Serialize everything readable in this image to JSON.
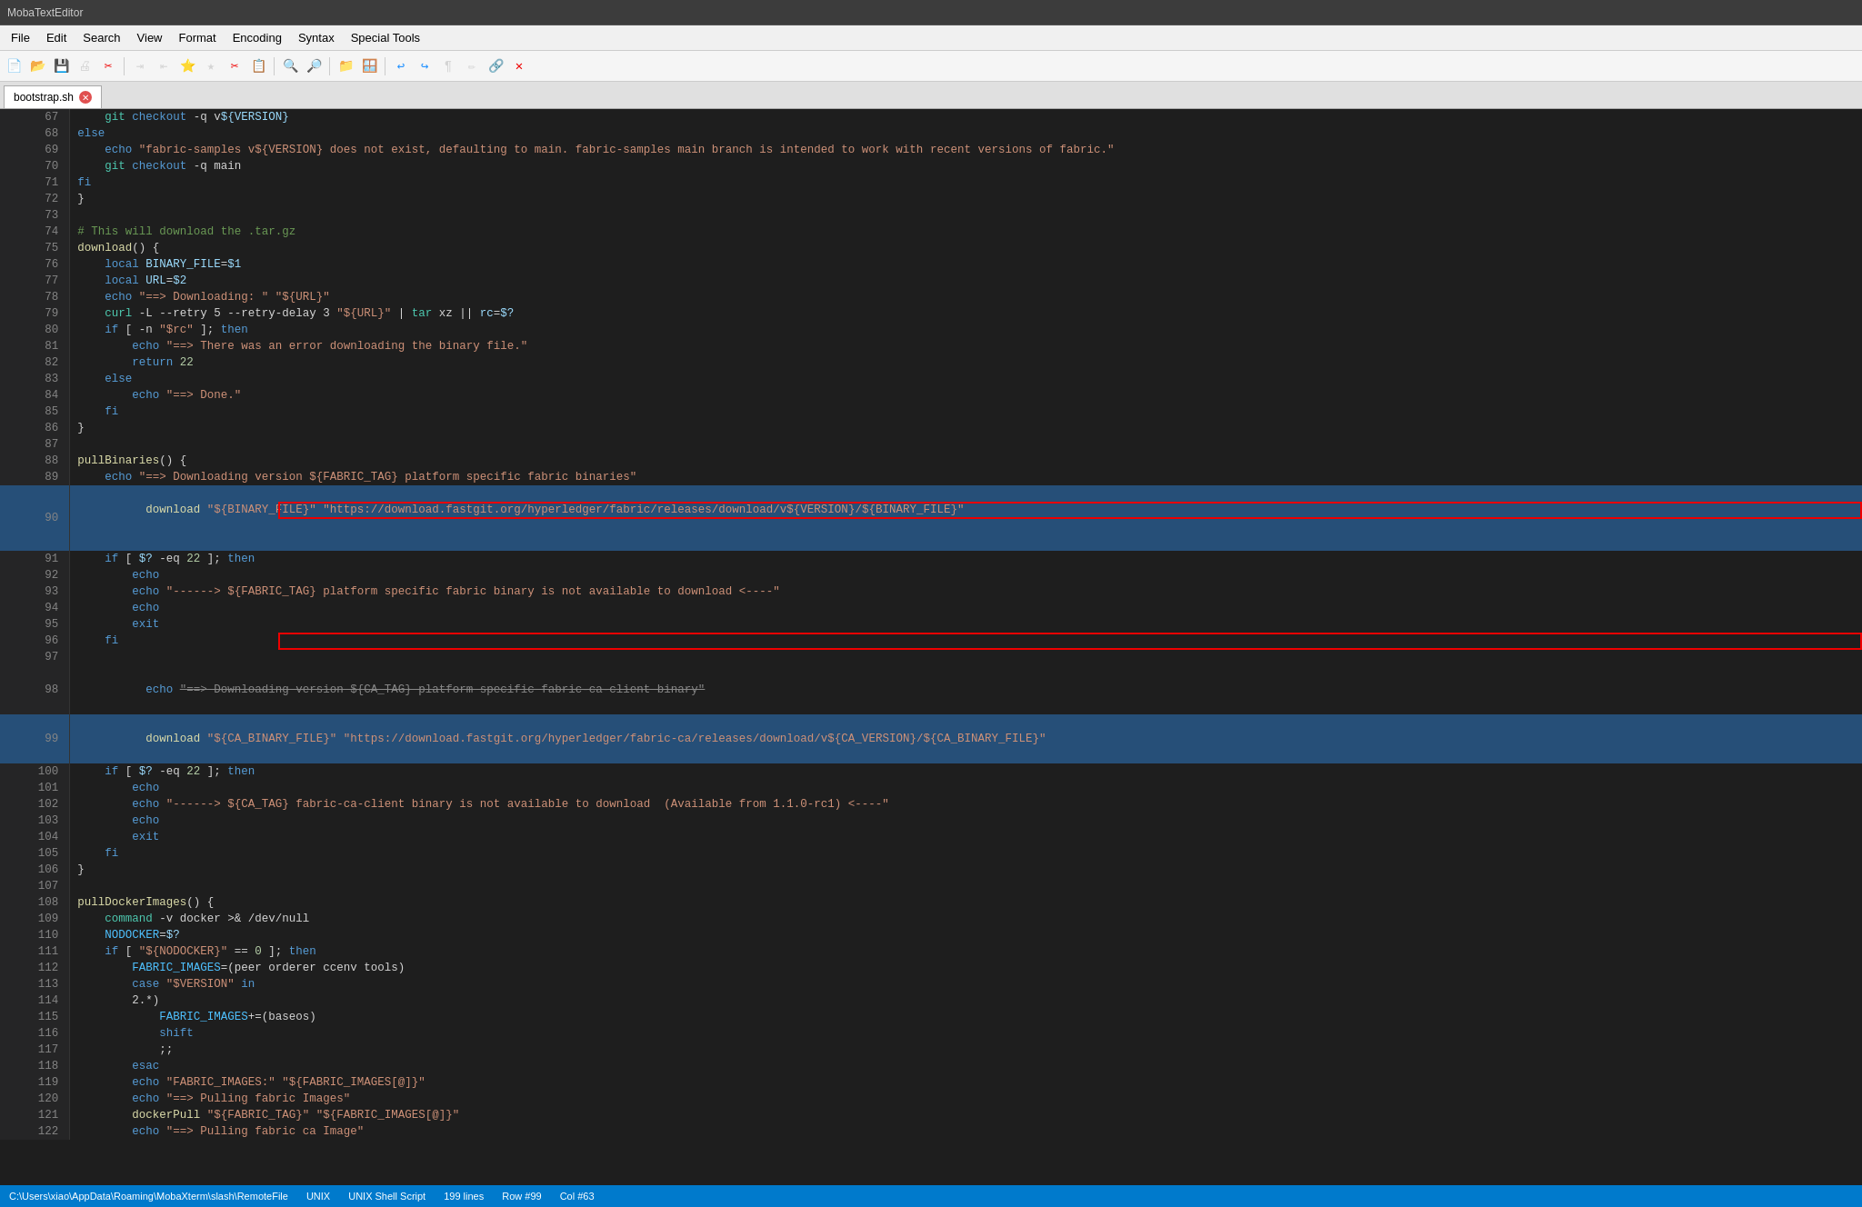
{
  "app": {
    "title": "MobaTextEditor"
  },
  "menubar": {
    "items": [
      "File",
      "Edit",
      "Search",
      "View",
      "Format",
      "Encoding",
      "Syntax",
      "Special Tools"
    ]
  },
  "tabs": [
    {
      "label": "bootstrap.sh",
      "active": true
    }
  ],
  "statusbar": {
    "path": "C:\\Users\\xiao\\AppData\\Roaming\\MobaXterm\\slash\\RemoteFile",
    "encoding": "UNIX",
    "type": "UNIX Shell Script",
    "lines": "199 lines",
    "row": "Row #99",
    "col": "Col #63"
  },
  "lines": [
    {
      "num": 67,
      "content": "    git checkout -q v${VERSION}"
    },
    {
      "num": 68,
      "content": "else"
    },
    {
      "num": 69,
      "content": "    echo \"fabric-samples v${VERSION} does not exist, defaulting to main. fabric-samples main branch is intended to work with recent versions of fabric.\""
    },
    {
      "num": 70,
      "content": "    git checkout -q main"
    },
    {
      "num": 71,
      "content": "fi"
    },
    {
      "num": 72,
      "content": "}"
    },
    {
      "num": 73,
      "content": ""
    },
    {
      "num": 74,
      "content": "# This will download the .tar.gz"
    },
    {
      "num": 75,
      "content": "download() {"
    },
    {
      "num": 76,
      "content": "    local BINARY_FILE=$1"
    },
    {
      "num": 77,
      "content": "    local URL=$2"
    },
    {
      "num": 78,
      "content": "    echo \"==> Downloading: \" \"${URL}\""
    },
    {
      "num": 79,
      "content": "    curl -L --retry 5 --retry-delay 3 \"${URL}\" | tar xz || rc=$?"
    },
    {
      "num": 80,
      "content": "    if [ -n \"$rc\" ]; then"
    },
    {
      "num": 81,
      "content": "        echo \"==> There was an error downloading the binary file.\""
    },
    {
      "num": 82,
      "content": "        return 22"
    },
    {
      "num": 83,
      "content": "    else"
    },
    {
      "num": 84,
      "content": "        echo \"==> Done.\""
    },
    {
      "num": 85,
      "content": "    fi"
    },
    {
      "num": 86,
      "content": "}"
    },
    {
      "num": 87,
      "content": ""
    },
    {
      "num": 88,
      "content": "pullBinaries() {"
    },
    {
      "num": 89,
      "content": "    echo \"==> Downloading version ${FABRIC_TAG} platform specific fabric binaries\""
    },
    {
      "num": 90,
      "content": "    download \"${BINARY_FILE}\" \"https://download.fastgit.org/hyperledger/fabric/releases/download/v${VERSION}/${BINARY_FILE}\"",
      "highlight": true
    },
    {
      "num": 91,
      "content": "    if [ $? -eq 22 ]; then"
    },
    {
      "num": 92,
      "content": "        echo"
    },
    {
      "num": 93,
      "content": "        echo \"------> ${FABRIC_TAG} platform specific fabric binary is not available to download <----\""
    },
    {
      "num": 94,
      "content": "        echo"
    },
    {
      "num": 95,
      "content": "        exit"
    },
    {
      "num": 96,
      "content": "    fi"
    },
    {
      "num": 97,
      "content": ""
    },
    {
      "num": 98,
      "content": "    echo \"==> Downloading version ${CA_TAG} platform specific fabric-ca-client binary\"",
      "strikelike": true
    },
    {
      "num": 99,
      "content": "    download \"${CA_BINARY_FILE}\" \"https://download.fastgit.org/hyperledger/fabric-ca/releases/download/v${CA_VERSION}/${CA_BINARY_FILE}\"",
      "highlight": true
    },
    {
      "num": 100,
      "content": "    if [ $? -eq 22 ]; then"
    },
    {
      "num": 101,
      "content": "        echo"
    },
    {
      "num": 102,
      "content": "        echo \"------> ${CA_TAG} fabric-ca-client binary is not available to download  (Available from 1.1.0-rc1) <----\""
    },
    {
      "num": 103,
      "content": "        echo"
    },
    {
      "num": 104,
      "content": "        exit"
    },
    {
      "num": 105,
      "content": "    fi"
    },
    {
      "num": 106,
      "content": "}"
    },
    {
      "num": 107,
      "content": ""
    },
    {
      "num": 108,
      "content": "pullDockerImages() {"
    },
    {
      "num": 109,
      "content": "    command -v docker >& /dev/null"
    },
    {
      "num": 110,
      "content": "    NODOCKER=$?"
    },
    {
      "num": 111,
      "content": "    if [ \"${NODOCKER}\" == 0 ]; then"
    },
    {
      "num": 112,
      "content": "        FABRIC_IMAGES=(peer orderer ccenv tools)"
    },
    {
      "num": 113,
      "content": "        case \"$VERSION\" in"
    },
    {
      "num": 114,
      "content": "        2.*)"
    },
    {
      "num": 115,
      "content": "            FABRIC_IMAGES+=(baseos)"
    },
    {
      "num": 116,
      "content": "            shift"
    },
    {
      "num": 117,
      "content": "            ;;"
    },
    {
      "num": 118,
      "content": "        esac"
    },
    {
      "num": 119,
      "content": "        echo \"FABRIC_IMAGES:\" \"${FABRIC_IMAGES[@]}\""
    },
    {
      "num": 120,
      "content": "        echo \"==> Pulling fabric Images\""
    },
    {
      "num": 121,
      "content": "        dockerPull \"${FABRIC_TAG}\" \"${FABRIC_IMAGES[@]}\""
    },
    {
      "num": 122,
      "content": "        echo \"==> Pulling fabric ca Image\""
    }
  ]
}
